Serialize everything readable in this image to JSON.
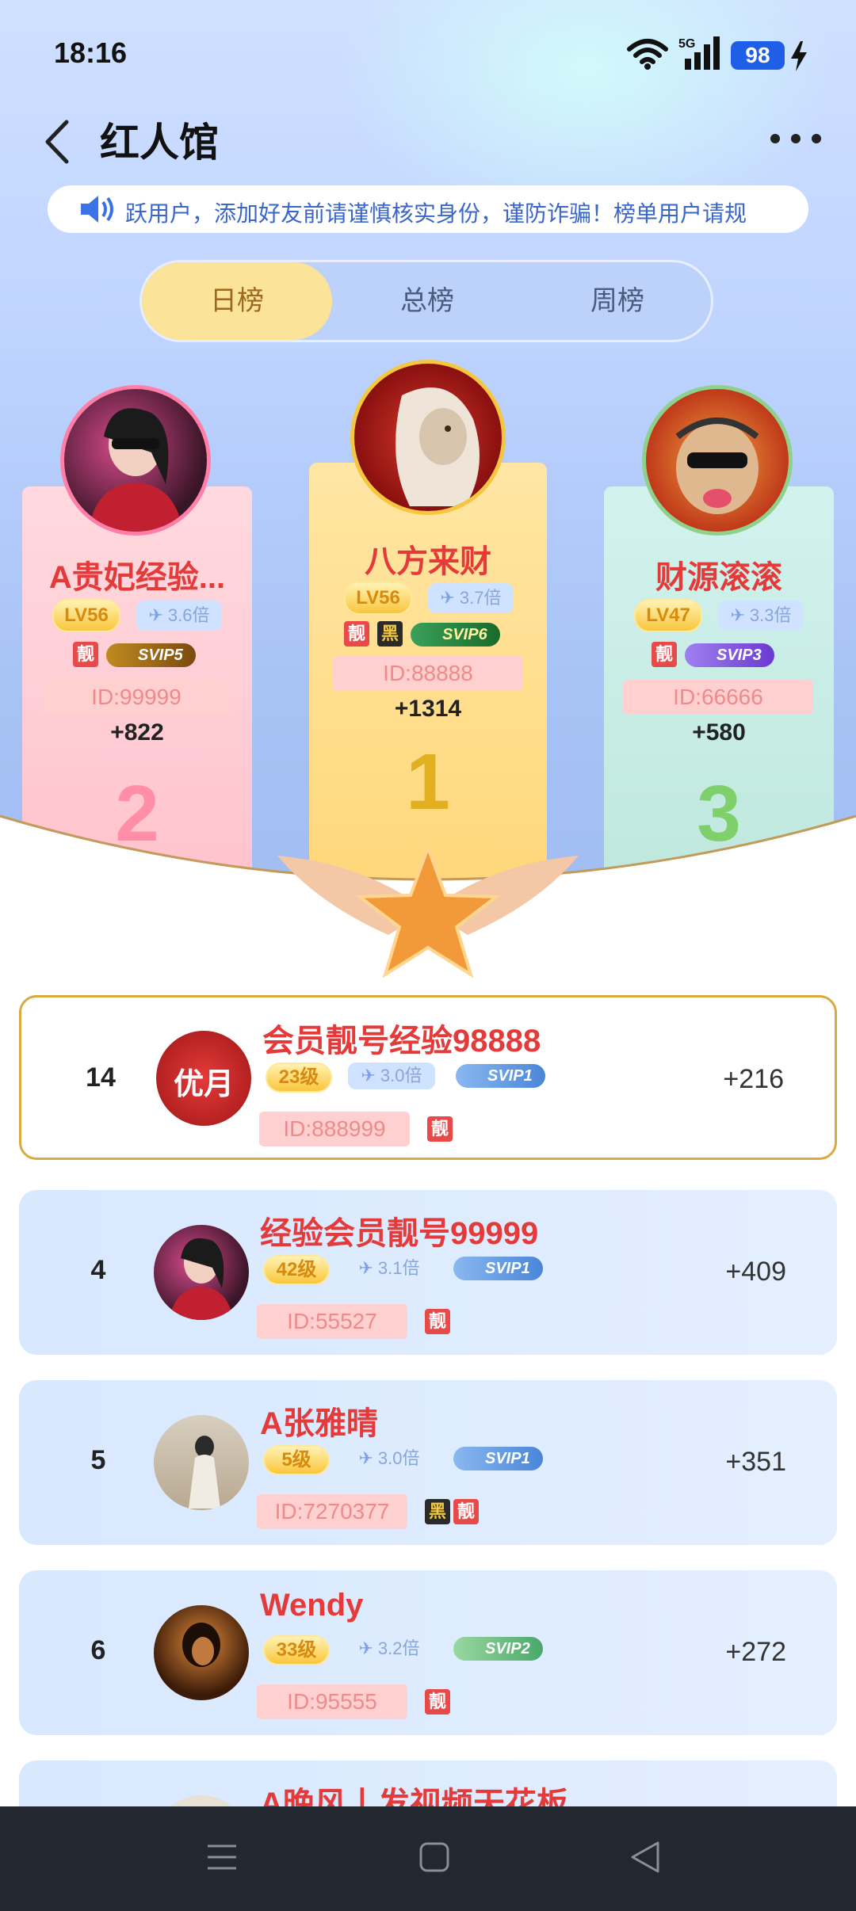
{
  "status": {
    "time": "18:16",
    "battery": "98",
    "network": "5G"
  },
  "nav": {
    "title": "红人馆"
  },
  "notice": {
    "text": "跃用户，添加好友前请谨慎核实身份，谨防诈骗！榜单用户请规"
  },
  "tabs": [
    {
      "label": "日榜",
      "active": true
    },
    {
      "label": "总榜",
      "active": false
    },
    {
      "label": "周榜",
      "active": false
    }
  ],
  "podium": {
    "first": {
      "rank": "1",
      "name": "八方来财",
      "lv": "LV56",
      "mult": "3.7倍",
      "tags": [
        "靓",
        "黑"
      ],
      "svip": "SVIP6",
      "id": "ID:88888",
      "score": "+1314"
    },
    "second": {
      "rank": "2",
      "name": "A贵妃经验...",
      "lv": "LV56",
      "mult": "3.6倍",
      "tags": [
        "靓"
      ],
      "svip": "SVIP5",
      "id": "ID:99999",
      "score": "+822"
    },
    "third": {
      "rank": "3",
      "name": "财源滚滚",
      "lv": "LV47",
      "mult": "3.3倍",
      "tags": [
        "靓"
      ],
      "svip": "SVIP3",
      "id": "ID:66666",
      "score": "+580"
    }
  },
  "my_row": {
    "rank": "14",
    "name": "会员靓号经验98888",
    "level": "23级",
    "mult": "3.0倍",
    "svip": "SVIP1",
    "id": "ID:888999",
    "tags": [
      "靓"
    ],
    "score": "+216",
    "avatar_text": "优月"
  },
  "list": [
    {
      "rank": "4",
      "name": "经验会员靓号99999",
      "level": "42级",
      "mult": "3.1倍",
      "svip": "SVIP1",
      "id": "ID:55527",
      "tags": [
        "靓"
      ],
      "score": "+409"
    },
    {
      "rank": "5",
      "name": "A张雅晴",
      "level": "5级",
      "mult": "3.0倍",
      "svip": "SVIP1",
      "id": "ID:7270377",
      "tags": [
        "黑",
        "靓"
      ],
      "score": "+351"
    },
    {
      "rank": "6",
      "name": "Wendy",
      "level": "33级",
      "mult": "3.2倍",
      "svip": "SVIP2",
      "id": "ID:95555",
      "tags": [
        "靓"
      ],
      "score": "+272"
    },
    {
      "rank": "",
      "name": "A晚风丨发视频天花板",
      "level": "",
      "mult": "",
      "svip": "",
      "id": "",
      "tags": [],
      "score": ""
    }
  ],
  "colors": {
    "accent_red": "#e53a3a",
    "svip_blue": "#5a8fe0",
    "gold": "#f9c63c"
  }
}
